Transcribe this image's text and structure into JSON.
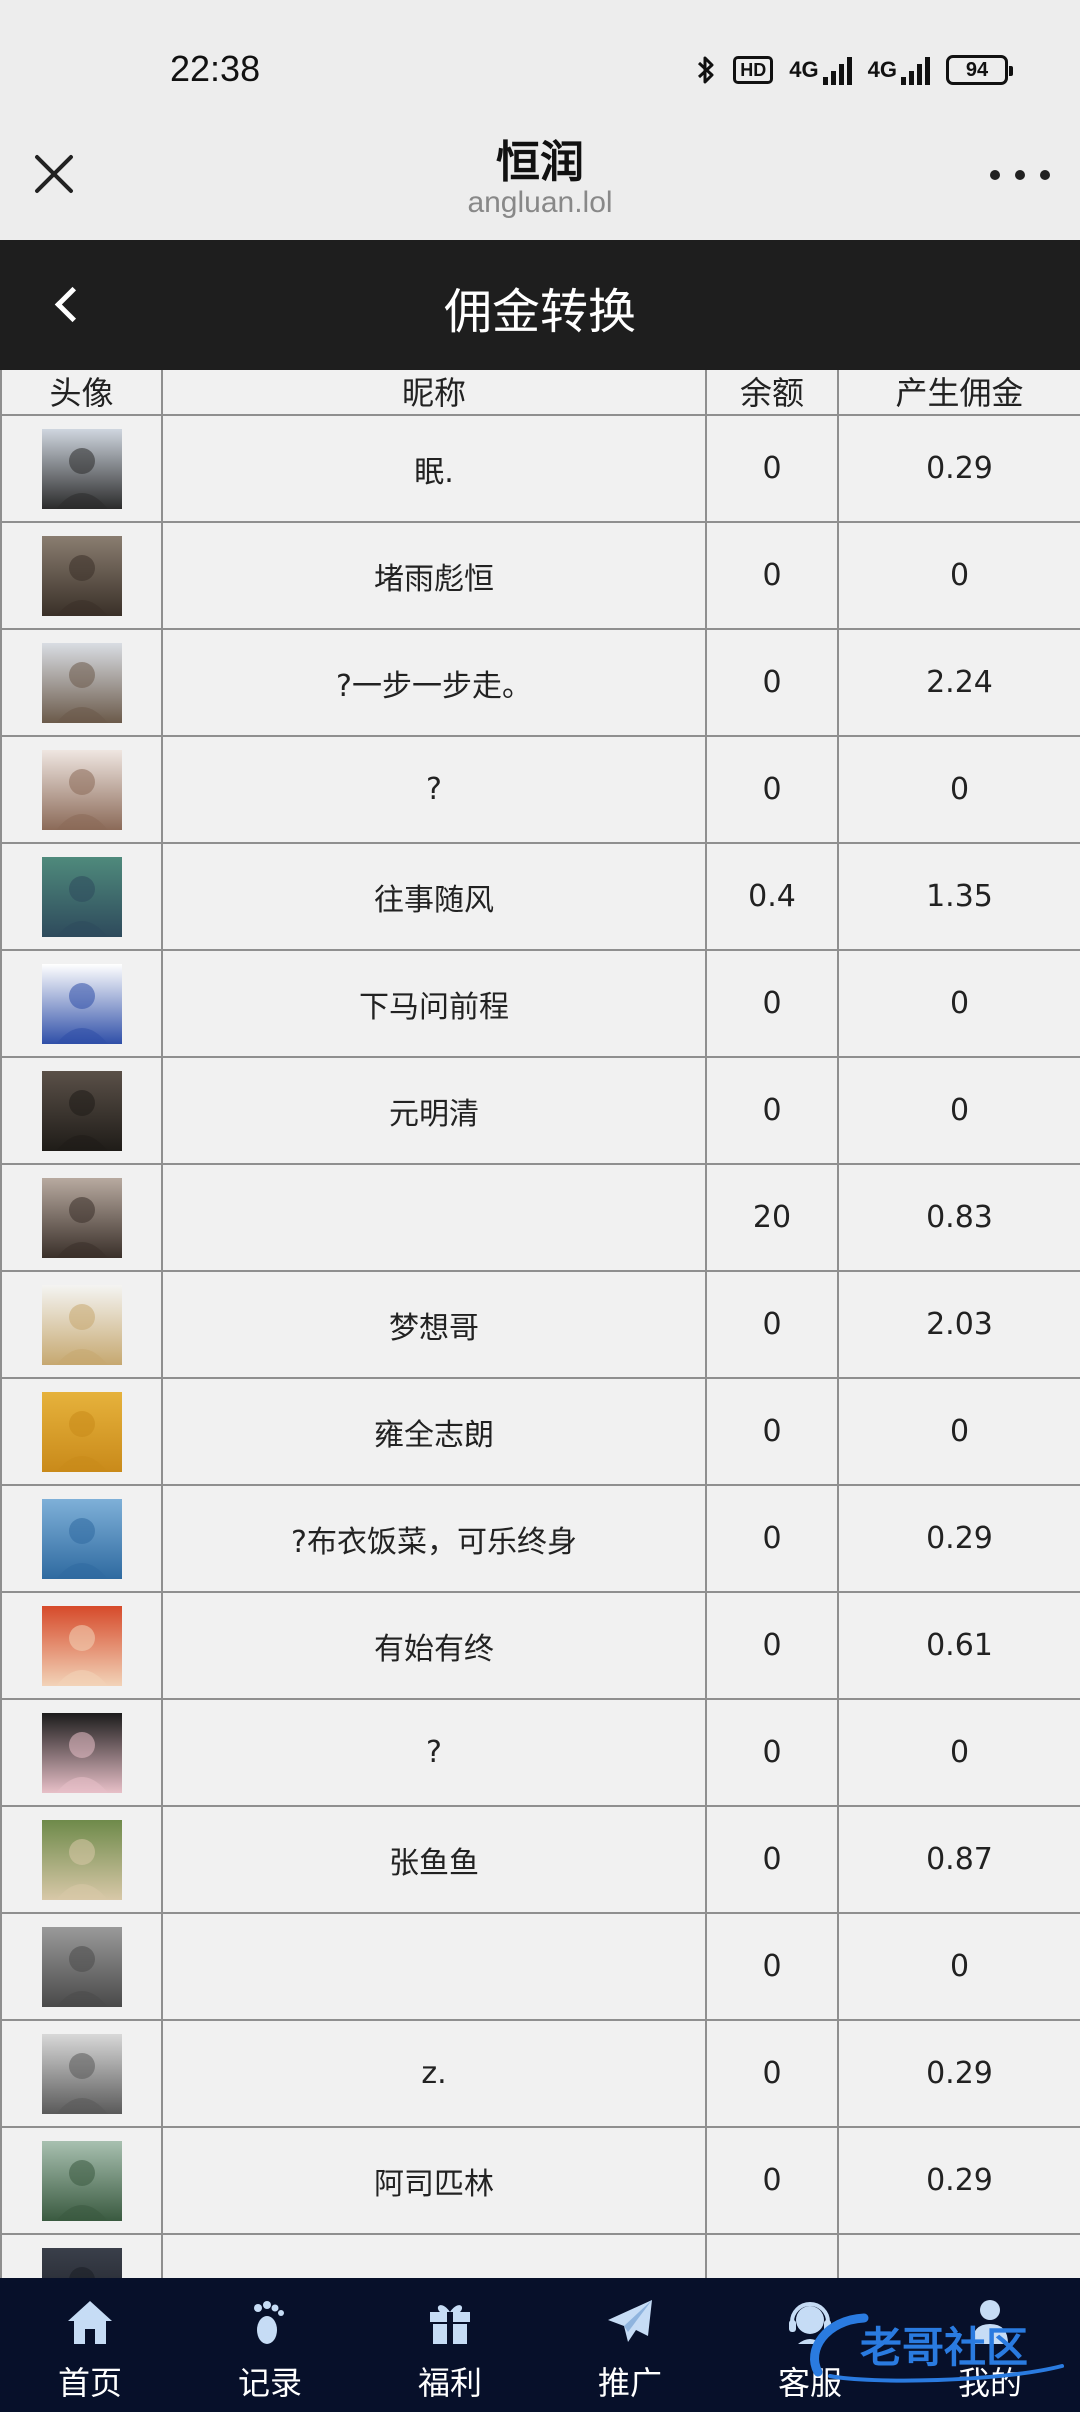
{
  "status_bar": {
    "time": "22:38",
    "network_1": "4G",
    "network_2": "4G",
    "hd_label": "HD",
    "battery": "94",
    "icons": [
      "bluetooth-icon",
      "hd-icon",
      "signal-icon",
      "signal-icon",
      "battery-icon"
    ]
  },
  "title_bar": {
    "title": "恒润",
    "url": "angluan.lol",
    "close_icon": "close-icon",
    "more_icon": "more-icon"
  },
  "header": {
    "title": "佣金转换",
    "back_icon": "back-chevron-icon"
  },
  "table": {
    "columns": [
      "头像",
      "昵称",
      "余额",
      "产生佣金"
    ],
    "rows": [
      {
        "nickname": "眠.",
        "balance": "0",
        "commission": "0.29",
        "avatar_colors": [
          "#cfd6df",
          "#2b2b2b"
        ]
      },
      {
        "nickname": "堵雨彪恒",
        "balance": "0",
        "commission": "0",
        "avatar_colors": [
          "#8a7d70",
          "#3a3028"
        ]
      },
      {
        "nickname": "?一步一步走。",
        "balance": "0",
        "commission": "2.24",
        "avatar_colors": [
          "#d9dde3",
          "#6b5a4a"
        ]
      },
      {
        "nickname": "?",
        "balance": "0",
        "commission": "0",
        "avatar_colors": [
          "#efe6e1",
          "#8b6a58"
        ]
      },
      {
        "nickname": "往事随风",
        "balance": "0.4",
        "commission": "1.35",
        "avatar_colors": [
          "#4f8a7c",
          "#2e4a5c"
        ]
      },
      {
        "nickname": "下马问前程",
        "balance": "0",
        "commission": "0",
        "avatar_colors": [
          "#ffffff",
          "#2f4fa8"
        ]
      },
      {
        "nickname": "元明清",
        "balance": "0",
        "commission": "0",
        "avatar_colors": [
          "#5a5048",
          "#1f1c18"
        ]
      },
      {
        "nickname": "",
        "balance": "20",
        "commission": "0.83",
        "avatar_colors": [
          "#b8aaa0",
          "#3a302a"
        ]
      },
      {
        "nickname": "梦想哥",
        "balance": "0",
        "commission": "2.03",
        "avatar_colors": [
          "#f4f4f2",
          "#c6a870"
        ]
      },
      {
        "nickname": "雍全志朗",
        "balance": "0",
        "commission": "0",
        "avatar_colors": [
          "#e6b23c",
          "#c98a1a"
        ]
      },
      {
        "nickname": "?布衣饭菜，可乐终身",
        "balance": "0",
        "commission": "0.29",
        "avatar_colors": [
          "#7fb0d8",
          "#2f6aa0"
        ]
      },
      {
        "nickname": "有始有终",
        "balance": "0",
        "commission": "0.61",
        "avatar_colors": [
          "#d64a2a",
          "#f2d3b8"
        ]
      },
      {
        "nickname": "?",
        "balance": "0",
        "commission": "0",
        "avatar_colors": [
          "#1c1c1c",
          "#e8c0c8"
        ]
      },
      {
        "nickname": "张鱼鱼",
        "balance": "0",
        "commission": "0.87",
        "avatar_colors": [
          "#6e8a4a",
          "#d8c8a8"
        ]
      },
      {
        "nickname": "",
        "balance": "0",
        "commission": "0",
        "avatar_colors": [
          "#9a9a9a",
          "#4a4a4a"
        ]
      },
      {
        "nickname": "z.",
        "balance": "0",
        "commission": "0.29",
        "avatar_colors": [
          "#d8d8d8",
          "#5a5a5a"
        ]
      },
      {
        "nickname": "阿司匹林",
        "balance": "0",
        "commission": "0.29",
        "avatar_colors": [
          "#a8c0b0",
          "#3a5a40"
        ]
      },
      {
        "nickname": "",
        "balance": "",
        "commission": "",
        "avatar_colors": [
          "#3a3f4a",
          "#1a1d24"
        ]
      }
    ]
  },
  "bottom_nav": {
    "items": [
      {
        "label": "首页",
        "icon": "home-icon"
      },
      {
        "label": "记录",
        "icon": "footprint-icon"
      },
      {
        "label": "福利",
        "icon": "gift-icon"
      },
      {
        "label": "推广",
        "icon": "paper-plane-icon"
      },
      {
        "label": "客服",
        "icon": "customer-service-icon"
      },
      {
        "label": "我的",
        "icon": "user-icon"
      }
    ]
  },
  "watermark": {
    "text": "老哥社区"
  },
  "colors": {
    "header_bg": "#1e1e1e",
    "nav_bg": "#07102a",
    "table_bg": "#f1f1f1",
    "border": "#8f8f8f",
    "watermark": "#2a7be0"
  }
}
